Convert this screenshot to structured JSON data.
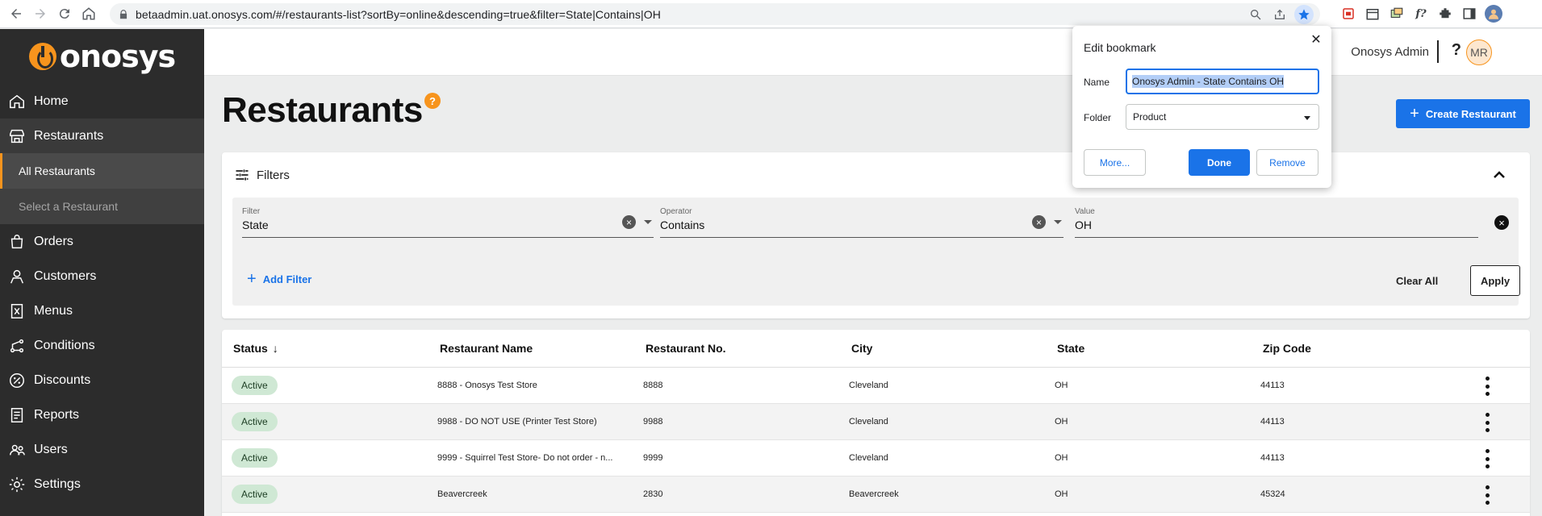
{
  "browser": {
    "url": "betaadmin.uat.onosys.com/#/restaurants-list?sortBy=online&descending=true&filter=State|Contains|OH",
    "extensions": [
      "pdf-icon",
      "calendar-icon",
      "screenshot-icon",
      "f?",
      "puzzle-icon",
      "sidebar-icon",
      "profile-icon"
    ],
    "extension_fx": "f?"
  },
  "brand": {
    "name": "onosys",
    "accent": "#f7941d"
  },
  "sidebar": {
    "items": [
      {
        "label": "Home",
        "icon": "home-icon"
      },
      {
        "label": "Restaurants",
        "icon": "store-icon"
      },
      {
        "label": "Orders",
        "icon": "bag-icon"
      },
      {
        "label": "Customers",
        "icon": "person-icon"
      },
      {
        "label": "Menus",
        "icon": "menu-icon"
      },
      {
        "label": "Conditions",
        "icon": "conditions-icon"
      },
      {
        "label": "Discounts",
        "icon": "percent-icon"
      },
      {
        "label": "Reports",
        "icon": "report-icon"
      },
      {
        "label": "Users",
        "icon": "users-icon"
      },
      {
        "label": "Settings",
        "icon": "gear-icon"
      }
    ],
    "subitems": [
      "All Restaurants",
      "Select a Restaurant"
    ]
  },
  "header": {
    "user": "Onosys Admin",
    "help": "?",
    "avatar": "MR"
  },
  "page": {
    "title": "Restaurants",
    "help_badge": "?",
    "create_label": "Create Restaurant"
  },
  "filters": {
    "title": "Filters",
    "filter_label": "Filter",
    "filter_value": "State",
    "operator_label": "Operator",
    "operator_value": "Contains",
    "value_label": "Value",
    "value_value": "OH",
    "add_label": "Add Filter",
    "clear_all": "Clear All",
    "apply": "Apply"
  },
  "table": {
    "headers": [
      "Status",
      "Restaurant Name",
      "Restaurant No.",
      "City",
      "State",
      "Zip Code"
    ],
    "sort_arrow": "↓",
    "rows": [
      {
        "status": "Active",
        "name": "8888 - Onosys Test Store",
        "number": "8888",
        "city": "Cleveland",
        "state": "OH",
        "zip": "44113"
      },
      {
        "status": "Active",
        "name": "9988 - DO NOT USE (Printer Test Store)",
        "number": "9988",
        "city": "Cleveland",
        "state": "OH",
        "zip": "44113"
      },
      {
        "status": "Active",
        "name": "9999 - Squirrel Test Store- Do not order - n...",
        "number": "9999",
        "city": "Cleveland",
        "state": "OH",
        "zip": "44113"
      },
      {
        "status": "Active",
        "name": "Beavercreek",
        "number": "2830",
        "city": "Beavercreek",
        "state": "OH",
        "zip": "45324"
      }
    ]
  },
  "bookmark": {
    "title": "Edit bookmark",
    "name_label": "Name",
    "name_value": "Onosys Admin - State Contains OH",
    "folder_label": "Folder",
    "folder_value": "Product",
    "more": "More...",
    "done": "Done",
    "remove": "Remove"
  }
}
